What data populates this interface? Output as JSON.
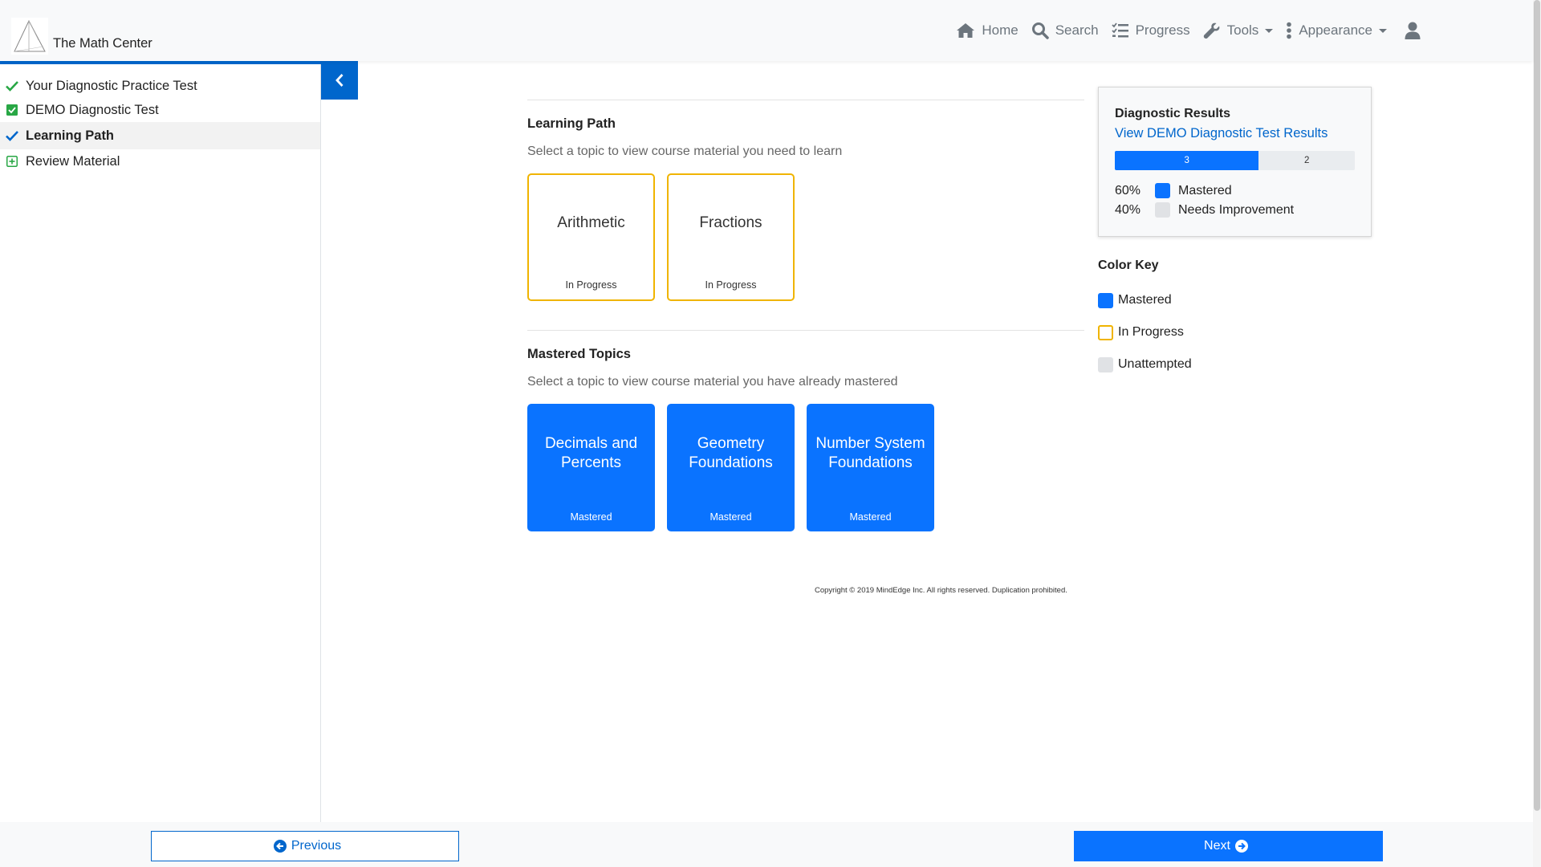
{
  "header": {
    "brand": "The Math Center",
    "nav": {
      "home": "Home",
      "search": "Search",
      "progress": "Progress",
      "tools": "Tools",
      "appearance": "Appearance"
    }
  },
  "sidebar": {
    "items": [
      {
        "label": "Your Diagnostic Practice Test",
        "icon": "check-icon"
      },
      {
        "label": "DEMO Diagnostic Test",
        "icon": "check-square-icon"
      },
      {
        "label": "Learning Path",
        "icon": "check-icon",
        "active": true
      },
      {
        "label": "Review Material",
        "icon": "plus-square-icon"
      }
    ]
  },
  "learning_path": {
    "title": "Learning Path",
    "subtitle": "Select a topic to view course material you need to learn",
    "topics": [
      {
        "name": "Arithmetic",
        "status": "In Progress"
      },
      {
        "name": "Fractions",
        "status": "In Progress"
      }
    ]
  },
  "mastered": {
    "title": "Mastered Topics",
    "subtitle": "Select a topic to view course material you have already mastered",
    "topics": [
      {
        "name": "Decimals and Percents",
        "status": "Mastered"
      },
      {
        "name": "Geometry Foundations",
        "status": "Mastered"
      },
      {
        "name": "Number System Foundations",
        "status": "Mastered"
      }
    ]
  },
  "copyright": "Copyright © 2019 MindEdge Inc. All rights reserved. Duplication prohibited.",
  "results": {
    "title": "Diagnostic Results",
    "link": "View DEMO Diagnostic Test Results",
    "bar": {
      "mastered_count": "3",
      "needs_count": "2",
      "mastered_fraction": 0.6
    },
    "rows": [
      {
        "pct": "60%",
        "label": "Mastered"
      },
      {
        "pct": "40%",
        "label": "Needs Improvement"
      }
    ]
  },
  "color_key": {
    "title": "Color Key",
    "items": [
      {
        "label": "Mastered"
      },
      {
        "label": "In Progress"
      },
      {
        "label": "Unattempted"
      }
    ]
  },
  "footer": {
    "previous": "Previous",
    "next": "Next"
  },
  "colors": {
    "primary": "#0066cc",
    "mastered": "#0a73ff",
    "in_progress": "#f0b400",
    "unattempted": "#e0e2e5",
    "success": "#28a745"
  }
}
